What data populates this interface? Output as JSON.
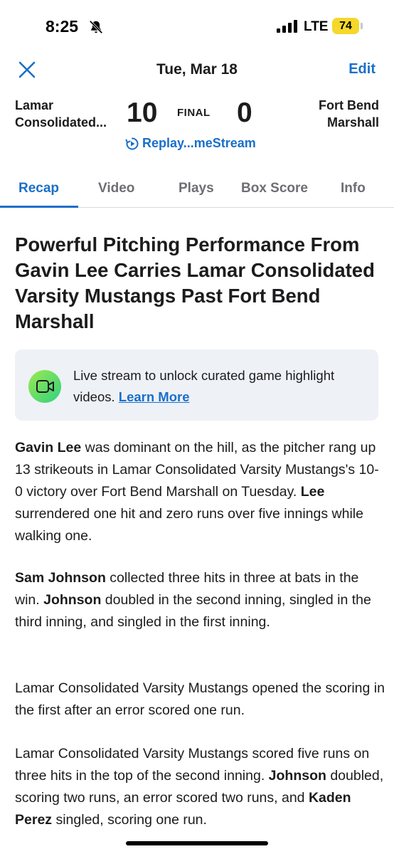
{
  "status_bar": {
    "time": "8:25",
    "network": "LTE",
    "battery": "74",
    "icons": [
      "bell-slash-icon",
      "signal-icon"
    ]
  },
  "header": {
    "date": "Tue, Mar 18",
    "edit_label": "Edit",
    "close_icon": "close-icon"
  },
  "scoreboard": {
    "home_team_line1": "Lamar",
    "home_team_line2": "Consolidated...",
    "home_score": "10",
    "status": "FINAL",
    "away_score": "0",
    "away_team_line1": "Fort Bend",
    "away_team_line2": "Marshall",
    "replay_label": "Replay...meStream"
  },
  "tabs": [
    {
      "label": "Recap",
      "active": true
    },
    {
      "label": "Video",
      "active": false
    },
    {
      "label": "Plays",
      "active": false
    },
    {
      "label": "Box Score",
      "active": false
    },
    {
      "label": "Info",
      "active": false
    }
  ],
  "article": {
    "headline": "Powerful Pitching Performance From Gavin Lee Carries Lamar Consolidated Varsity Mustangs Past Fort Bend Marshall",
    "promo": {
      "text": "Live stream to unlock curated game highlight videos.",
      "link": "Learn More"
    },
    "p1": {
      "b1": "Gavin Lee",
      "t1": " was dominant on the hill, as the pitcher rang up 13 strikeouts in Lamar Consolidated Varsity Mustangs's 10-0 victory over Fort Bend Marshall on Tuesday. ",
      "b2": "Lee",
      "t2": " surrendered one hit and zero runs over five innings while walking one."
    },
    "p2": {
      "b1": "Sam Johnson",
      "t1": " collected three hits in three at bats in the win. ",
      "b2": "Johnson",
      "t2": " doubled in the second inning, singled in the third inning, and singled in the first inning."
    },
    "p3": {
      "t1": "Lamar Consolidated Varsity Mustangs opened the scoring in the first after an error scored one run."
    },
    "p4": {
      "t1": "Lamar Consolidated Varsity Mustangs scored five runs on three hits in the top of the second inning. ",
      "b1": "Johnson",
      "t2": " doubled, scoring two runs, an error scored two runs, and ",
      "b2": "Kaden Perez",
      "t3": " singled, scoring one run."
    }
  },
  "colors": {
    "accent": "#1a6fc9",
    "text": "#1c1c1e",
    "muted": "#6e6e73",
    "battery": "#f5d82a",
    "promo_bg": "#eef1f6"
  }
}
